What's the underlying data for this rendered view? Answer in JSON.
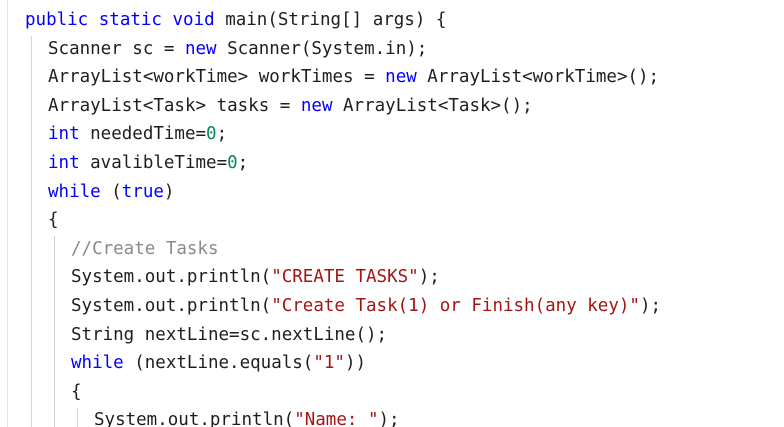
{
  "colors": {
    "keyword": "#0000ff",
    "number": "#098658",
    "string": "#a31515",
    "comment": "#8a8a8a",
    "text": "#1e1e1e",
    "background": "#ffffff"
  },
  "code": {
    "lines": [
      {
        "indent": 0,
        "tokens": [
          {
            "type": "kw",
            "text": "public static void"
          },
          {
            "type": "txt",
            "text": " main(String[] args) {"
          }
        ]
      },
      {
        "indent": 1,
        "tokens": [
          {
            "type": "txt",
            "text": "Scanner sc = "
          },
          {
            "type": "kw",
            "text": "new"
          },
          {
            "type": "txt",
            "text": " Scanner(System.in);"
          }
        ]
      },
      {
        "indent": 1,
        "tokens": [
          {
            "type": "txt",
            "text": "ArrayList<workTime> workTimes = "
          },
          {
            "type": "kw",
            "text": "new"
          },
          {
            "type": "txt",
            "text": " ArrayList<workTime>();"
          }
        ]
      },
      {
        "indent": 1,
        "tokens": [
          {
            "type": "txt",
            "text": "ArrayList<Task> tasks = "
          },
          {
            "type": "kw",
            "text": "new"
          },
          {
            "type": "txt",
            "text": " ArrayList<Task>();"
          }
        ]
      },
      {
        "indent": 1,
        "tokens": [
          {
            "type": "kw",
            "text": "int"
          },
          {
            "type": "txt",
            "text": " neededTime="
          },
          {
            "type": "num",
            "text": "0"
          },
          {
            "type": "txt",
            "text": ";"
          }
        ]
      },
      {
        "indent": 1,
        "tokens": [
          {
            "type": "kw",
            "text": "int"
          },
          {
            "type": "txt",
            "text": " avalibleTime="
          },
          {
            "type": "num",
            "text": "0"
          },
          {
            "type": "txt",
            "text": ";"
          }
        ]
      },
      {
        "indent": 1,
        "tokens": [
          {
            "type": "kw",
            "text": "while"
          },
          {
            "type": "txt",
            "text": " ("
          },
          {
            "type": "kw",
            "text": "true"
          },
          {
            "type": "txt",
            "text": ")"
          }
        ]
      },
      {
        "indent": 1,
        "tokens": [
          {
            "type": "txt",
            "text": "{"
          }
        ]
      },
      {
        "indent": 2,
        "tokens": [
          {
            "type": "cmt",
            "text": "//Create Tasks"
          }
        ]
      },
      {
        "indent": 2,
        "tokens": [
          {
            "type": "txt",
            "text": "System.out.println("
          },
          {
            "type": "str",
            "text": "\"CREATE TASKS\""
          },
          {
            "type": "txt",
            "text": ");"
          }
        ]
      },
      {
        "indent": 2,
        "tokens": [
          {
            "type": "txt",
            "text": "System.out.println("
          },
          {
            "type": "str",
            "text": "\"Create Task(1) or Finish(any key)\""
          },
          {
            "type": "txt",
            "text": ");"
          }
        ]
      },
      {
        "indent": 2,
        "tokens": [
          {
            "type": "txt",
            "text": "String nextLine=sc.nextLine();"
          }
        ]
      },
      {
        "indent": 2,
        "tokens": [
          {
            "type": "kw",
            "text": "while"
          },
          {
            "type": "txt",
            "text": " (nextLine.equals("
          },
          {
            "type": "str",
            "text": "\"1\""
          },
          {
            "type": "txt",
            "text": "))"
          }
        ]
      },
      {
        "indent": 2,
        "tokens": [
          {
            "type": "txt",
            "text": "{"
          }
        ]
      },
      {
        "indent": 3,
        "tokens": [
          {
            "type": "txt",
            "text": "System.out.println("
          },
          {
            "type": "str",
            "text": "\"Name: \""
          },
          {
            "type": "txt",
            "text": ");"
          }
        ]
      }
    ]
  }
}
